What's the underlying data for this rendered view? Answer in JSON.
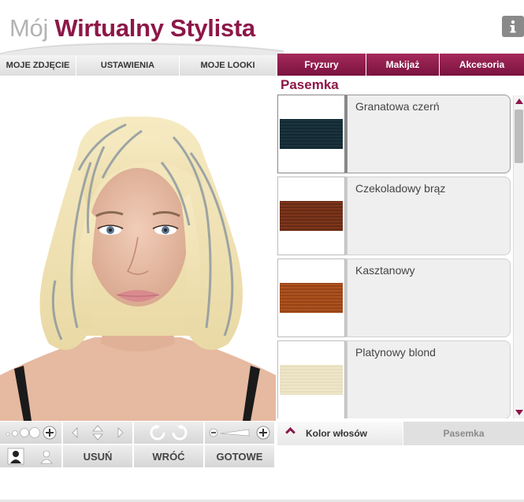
{
  "header": {
    "title_part1": "Mój",
    "title_part2": "Wirtualny Stylista",
    "info_icon": "info-icon"
  },
  "left_tabs": [
    "MOJE ZDJĘCIE",
    "USTAWIENIA",
    "MOJE LOOKI"
  ],
  "right_tabs": [
    "Fryzury",
    "Makijaż",
    "Akcesoria"
  ],
  "section_title": "Pasemka",
  "swatches": [
    {
      "label": "Granatowa czerń",
      "color": "#10232c",
      "color2": "#1d3a45",
      "selected": true
    },
    {
      "label": "Czekoladowy brąz",
      "color": "#5a2512",
      "color2": "#8a3c1f",
      "selected": false
    },
    {
      "label": "Kasztanowy",
      "color": "#8c3c12",
      "color2": "#b85a23",
      "selected": false
    },
    {
      "label": "Platynowy blond",
      "color": "#f1ead0",
      "color2": "#e5dab8",
      "selected": false
    }
  ],
  "controls": {
    "remove_label": "USUŃ",
    "back_label": "WRÓĆ",
    "done_label": "GOTOWE",
    "zoom_minus_icon": "minus-icon",
    "zoom_plus_icon": "plus-icon"
  },
  "bottom_right": {
    "hair_color_label": "Kolor włosów",
    "highlights_label": "Pasemka"
  },
  "colors": {
    "brand": "#8d1748",
    "tab_bg": "#7a1240",
    "title_grey": "#b3b3b3"
  }
}
